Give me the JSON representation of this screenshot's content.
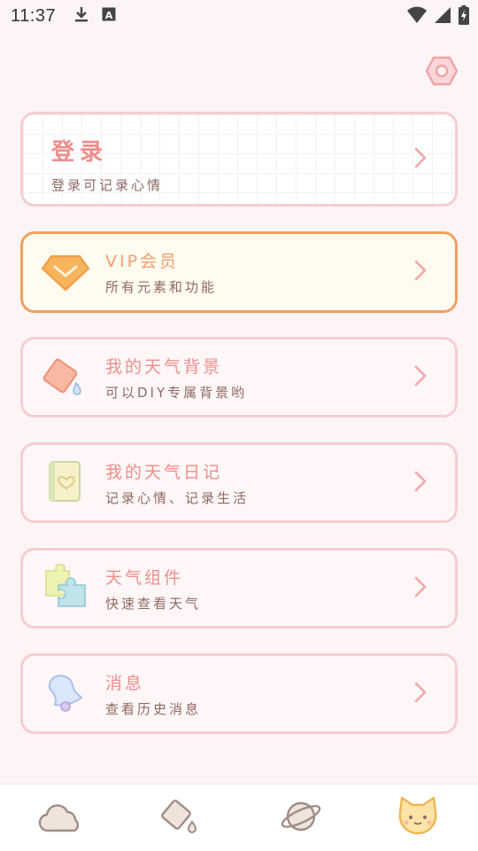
{
  "status": {
    "time": "11:37",
    "icons_left": [
      "download-icon",
      "a-badge-icon"
    ],
    "icons_right": [
      "wifi-icon",
      "signal-icon",
      "battery-charging-icon"
    ]
  },
  "settings": {
    "icon": "hexagon-settings-icon"
  },
  "login": {
    "title": "登录",
    "subtitle": "登录可记录心情"
  },
  "menu": [
    {
      "id": "vip",
      "title": "VIP会员",
      "subtitle": "所有元素和功能",
      "icon": "diamond-icon"
    },
    {
      "id": "background",
      "title": "我的天气背景",
      "subtitle": "可以DIY专属背景哟",
      "icon": "paint-bucket-icon"
    },
    {
      "id": "diary",
      "title": "我的天气日记",
      "subtitle": "记录心情、记录生活",
      "icon": "diary-book-icon"
    },
    {
      "id": "widget",
      "title": "天气组件",
      "subtitle": "快速查看天气",
      "icon": "puzzle-icon"
    },
    {
      "id": "messages",
      "title": "消息",
      "subtitle": "查看历史消息",
      "icon": "bell-icon"
    }
  ],
  "bottom_nav": [
    {
      "id": "weather",
      "icon": "cloud-icon"
    },
    {
      "id": "background",
      "icon": "paint-bucket-icon"
    },
    {
      "id": "explore",
      "icon": "planet-icon"
    },
    {
      "id": "mine",
      "icon": "cat-face-icon",
      "active": true
    }
  ],
  "colors": {
    "background": "#fdf5f5",
    "card_border": "#f5cdd0",
    "title_pink": "#f08c8c",
    "subtitle_brown": "#8d6a63",
    "vip_border": "#f0a060",
    "vip_bg": "#fffbee"
  }
}
